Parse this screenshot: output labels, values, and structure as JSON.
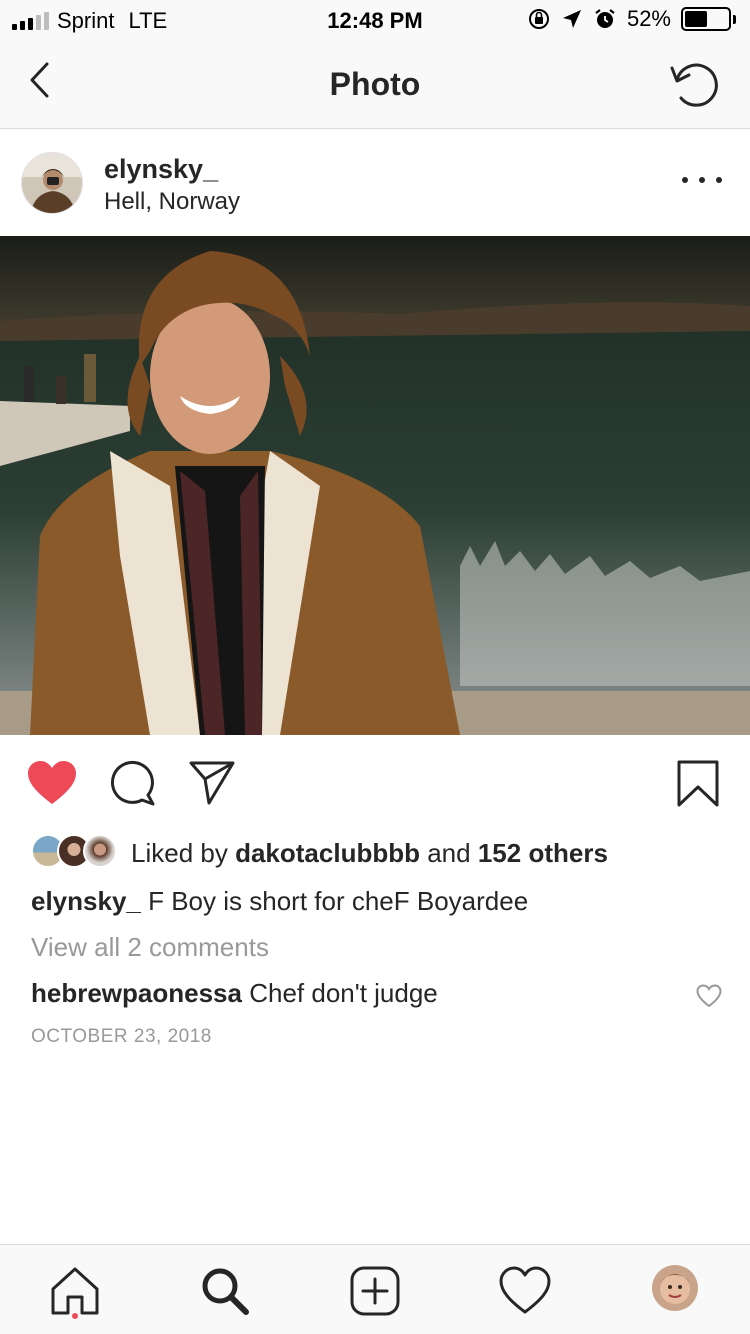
{
  "status_bar": {
    "carrier": "Sprint",
    "network": "LTE",
    "time": "12:48 PM",
    "battery_percent": "52%",
    "battery_level": 0.52
  },
  "nav": {
    "title": "Photo",
    "back_icon": "chevron-left-icon",
    "refresh_icon": "refresh-icon"
  },
  "post": {
    "username": "elynsky_",
    "location": "Hell, Norway",
    "more_icon": "more-dots-icon"
  },
  "actions": {
    "liked": true,
    "like_color": "#ed4956",
    "icons": [
      "heart-icon",
      "comment-icon",
      "share-icon",
      "bookmark-icon"
    ]
  },
  "likes": {
    "prefix": "Liked by",
    "user": "dakotaclubbbb",
    "joiner": "and",
    "others": "152 others"
  },
  "caption": {
    "username": "elynsky_",
    "text": "F Boy is short for cheF Boyardee"
  },
  "comments": {
    "view_all": "View all 2 comments",
    "items": [
      {
        "username": "hebrewpaonessa",
        "text": "Chef don't judge"
      }
    ]
  },
  "date": "OCTOBER 23, 2018",
  "tab_bar": {
    "icons": [
      "home-icon",
      "search-icon",
      "add-post-icon",
      "activity-icon",
      "profile-avatar"
    ],
    "notification_dot_color": "#ed4956"
  }
}
